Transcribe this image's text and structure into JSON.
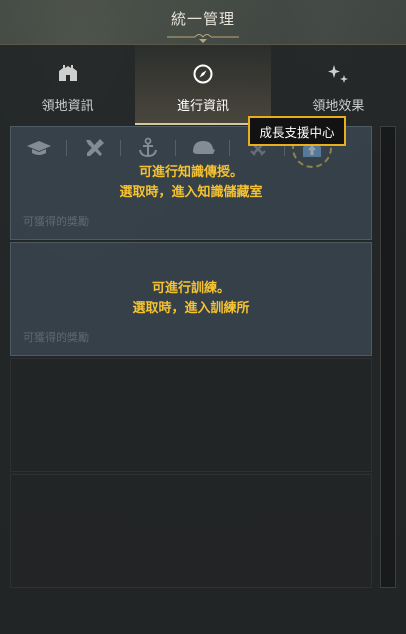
{
  "window": {
    "title": "統一管理"
  },
  "tabs": [
    {
      "label": "領地資訊",
      "icon": "castle-icon"
    },
    {
      "label": "進行資訊",
      "icon": "compass-icon",
      "active": true
    },
    {
      "label": "領地效果",
      "icon": "sparkle-icon"
    }
  ],
  "subtabs": [
    {
      "icon": "graduation-cap-icon"
    },
    {
      "icon": "crossed-tools-icon"
    },
    {
      "icon": "anchor-icon"
    },
    {
      "icon": "helmet-icon"
    },
    {
      "icon": "crossed-swords-icon"
    },
    {
      "icon": "growth-support-icon",
      "highlighted": true
    }
  ],
  "tooltip": {
    "text": "成長支援中心"
  },
  "cards": [
    {
      "line1": "可進行知識傳授。",
      "line2": "選取時，進入知識儲藏室",
      "ghost": "可獲得的獎勵"
    },
    {
      "line1": "可進行訓練。",
      "line2": "選取時，進入訓練所",
      "ghost": "可獲得的獎勵"
    }
  ],
  "colors": {
    "accent": "#e8ae1c",
    "message": "#f5c230",
    "tab_underline": "#d7c7a0"
  }
}
